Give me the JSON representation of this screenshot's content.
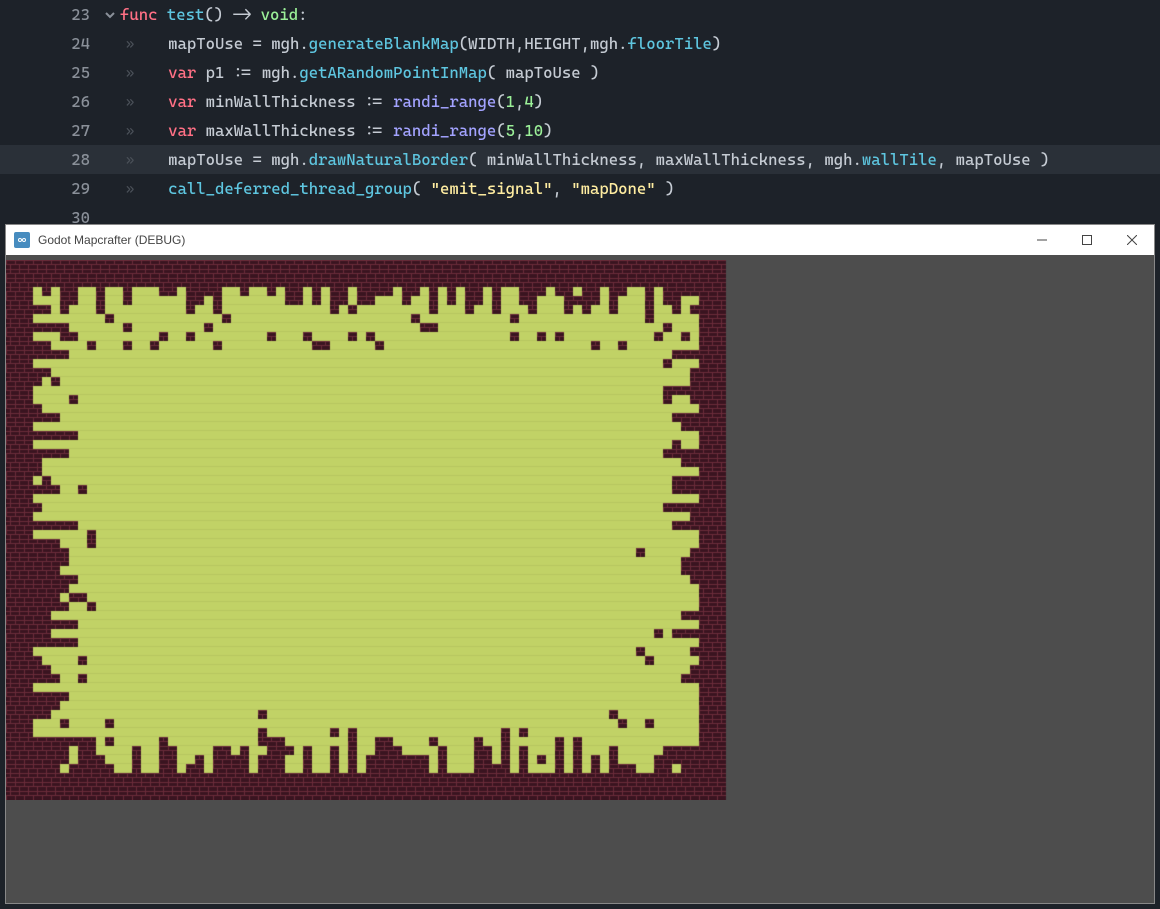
{
  "code": {
    "lines": [
      {
        "num": "23",
        "fold": true,
        "indent": 0
      },
      {
        "num": "24",
        "indent": 1
      },
      {
        "num": "25",
        "indent": 1
      },
      {
        "num": "26",
        "indent": 1
      },
      {
        "num": "27",
        "indent": 1
      },
      {
        "num": "28",
        "indent": 1,
        "highlighted": true
      },
      {
        "num": "29",
        "indent": 1
      },
      {
        "num": "30",
        "indent": 0
      }
    ],
    "tokens": {
      "l23": {
        "func": "func",
        "name": "test",
        "parens": "()",
        "arrow": " -> ",
        "void": "void",
        "colon": ":"
      },
      "l24": {
        "lhs": "mapToUse",
        "eq": " = ",
        "obj": "mgh",
        "dot": ".",
        "method": "generateBlankMap",
        "open": "(",
        "a1": "WIDTH",
        "c1": ",",
        "a2": "HEIGHT",
        "c2": ",",
        "obj2": "mgh",
        "dot2": ".",
        "prop": "floorTile",
        "close": ")"
      },
      "l25": {
        "var": "var",
        "name": " p1 ",
        "assign": ":= ",
        "obj": "mgh",
        "dot": ".",
        "method": "getARandomPointInMap",
        "open": "( ",
        "arg": "mapToUse",
        "close": " )"
      },
      "l26": {
        "var": "var",
        "name": " minWallThickness ",
        "assign": ":= ",
        "fn": "randi_range",
        "open": "(",
        "a1": "1",
        "c": ",",
        "a2": "4",
        "close": ")"
      },
      "l27": {
        "var": "var",
        "name": " maxWallThickness ",
        "assign": ":= ",
        "fn": "randi_range",
        "open": "(",
        "a1": "5",
        "c": ",",
        "a2": "10",
        "close": ")"
      },
      "l28": {
        "lhs": "mapToUse",
        "eq": " = ",
        "obj": "mgh",
        "dot": ".",
        "method": "drawNaturalBorder",
        "open": "( ",
        "a1": "minWallThickness",
        "c1": ", ",
        "a2": "maxWallThickness",
        "c2": ", ",
        "obj2": "mgh",
        "dot2": ".",
        "prop": "wallTile",
        "c3": ", ",
        "a4": "mapToUse",
        "close": " )"
      },
      "l29": {
        "fn": "call_deferred_thread_group",
        "open": "( ",
        "s1": "\"emit_signal\"",
        "c": ", ",
        "s2": "\"mapDone\"",
        "close": " )"
      }
    }
  },
  "window": {
    "title": "Godot Mapcrafter (DEBUG)"
  },
  "map": {
    "width": 80,
    "height": 60,
    "floorColor": "#c1d266",
    "wallBrick": "#3a1420",
    "wallMortar": "#6a2c3a",
    "cellSize": 9,
    "minWallThickness": 1,
    "maxWallThickness": 10
  }
}
